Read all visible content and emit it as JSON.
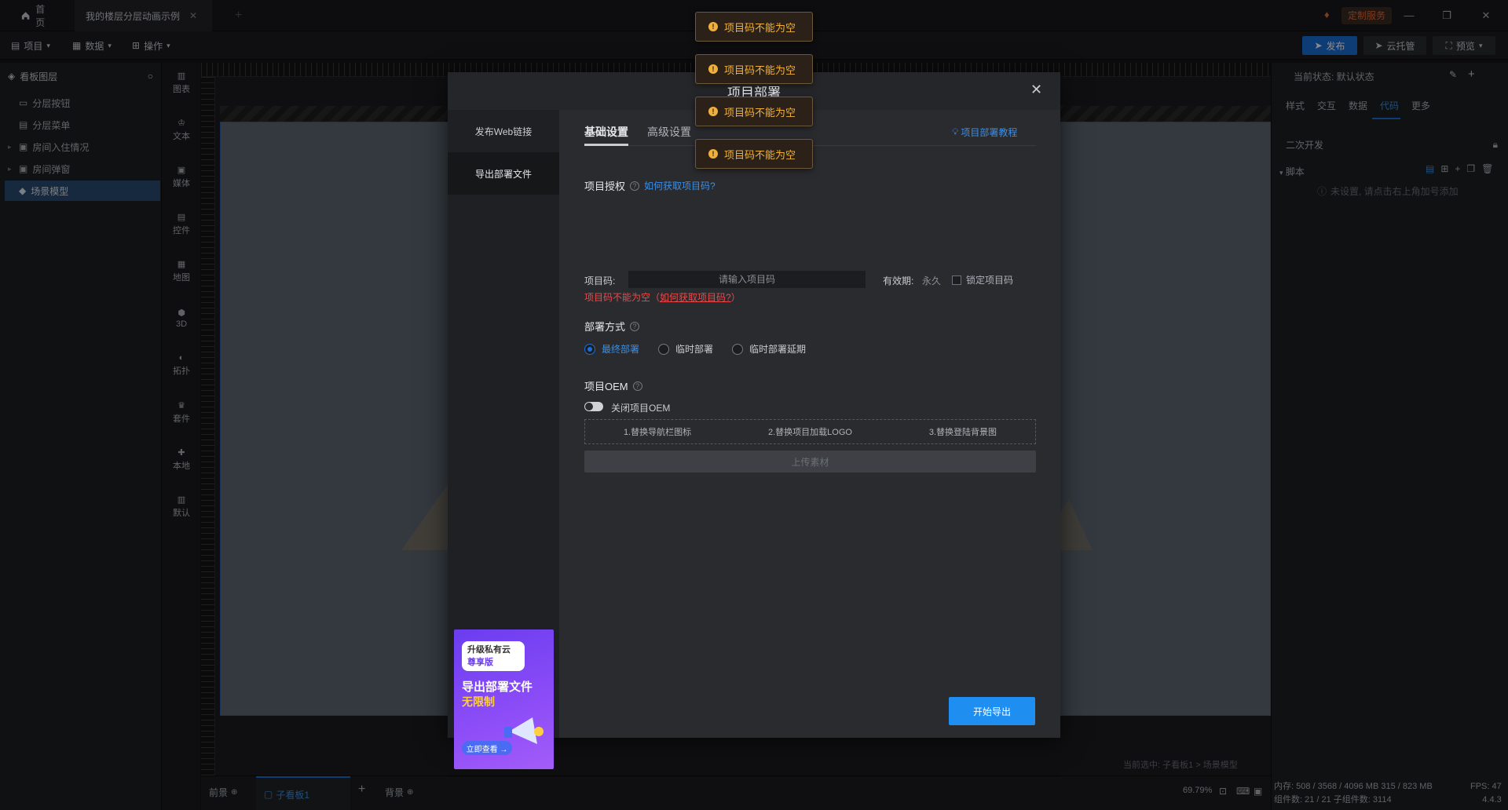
{
  "titlebar": {
    "home_tab": "首页",
    "doc_tab": "我的楼层分层动画示例",
    "custom_service": "定制服务"
  },
  "menubar": {
    "project": "项目",
    "data": "数据",
    "operate": "操作",
    "publish": "发布",
    "cloud": "云托管",
    "preview": "预览"
  },
  "layers": {
    "header": "看板图层",
    "items": [
      "分层按钮",
      "分层菜单",
      "房间入住情况",
      "房间弹窗",
      "场景模型"
    ]
  },
  "components": [
    "图表",
    "文本",
    "媒体",
    "控件",
    "地图",
    "3D",
    "拓扑",
    "套件",
    "本地",
    "默认"
  ],
  "canvas": {
    "selection_path": "当前选中: 子看板1 > 场景模型"
  },
  "bottombar": {
    "front": "前景",
    "sub_board": "子看板1",
    "background": "背景",
    "zoom": "69.79%"
  },
  "rightpanel": {
    "status": "当前状态: 默认状态",
    "tabs": [
      "样式",
      "交互",
      "数据",
      "代码",
      "更多"
    ],
    "secondary_dev": "二次开发",
    "script": "脚本",
    "empty_hint": "未设置, 请点击右上角加号添加",
    "mem": "内存: 508 / 3568 / 4096 MB  315 / 823 MB",
    "components_count": "组件数: 21 / 21   子组件数: 3114",
    "fps": "FPS: 47",
    "version": "4.4.3"
  },
  "modal": {
    "title": "项目部署",
    "nav": [
      "发布Web链接",
      "导出部署文件"
    ],
    "tabs": [
      "基础设置",
      "高级设置"
    ],
    "tutorial_link": "项目部署教程",
    "auth_title": "项目授权",
    "how_to_get": "如何获取项目码?",
    "code_label": "项目码:",
    "code_placeholder": "请输入项目码",
    "validity_label": "有效期:",
    "validity_value": "永久",
    "lock_label": "锁定项目码",
    "error_prefix": "项目码不能为空（",
    "error_link": "如何获取项目码?",
    "error_suffix": "）",
    "deploy_title": "部署方式",
    "deploy_options": [
      "最终部署",
      "临时部署",
      "临时部署延期"
    ],
    "oem_title": "项目OEM",
    "oem_toggle_label": "关闭项目OEM",
    "oem_steps": [
      "1.替换导航栏图标",
      "2.替换项目加载LOGO",
      "3.替换登陆背景图"
    ],
    "upload_label": "上传素材",
    "export_label": "开始导出"
  },
  "ad": {
    "line1": "升级私有云",
    "line2": "尊享版",
    "title": "导出部署文件",
    "subtitle": "无限制",
    "cta": "立即查看 →"
  },
  "toasts": [
    "项目码不能为空",
    "项目码不能为空",
    "项目码不能为空",
    "项目码不能为空"
  ]
}
